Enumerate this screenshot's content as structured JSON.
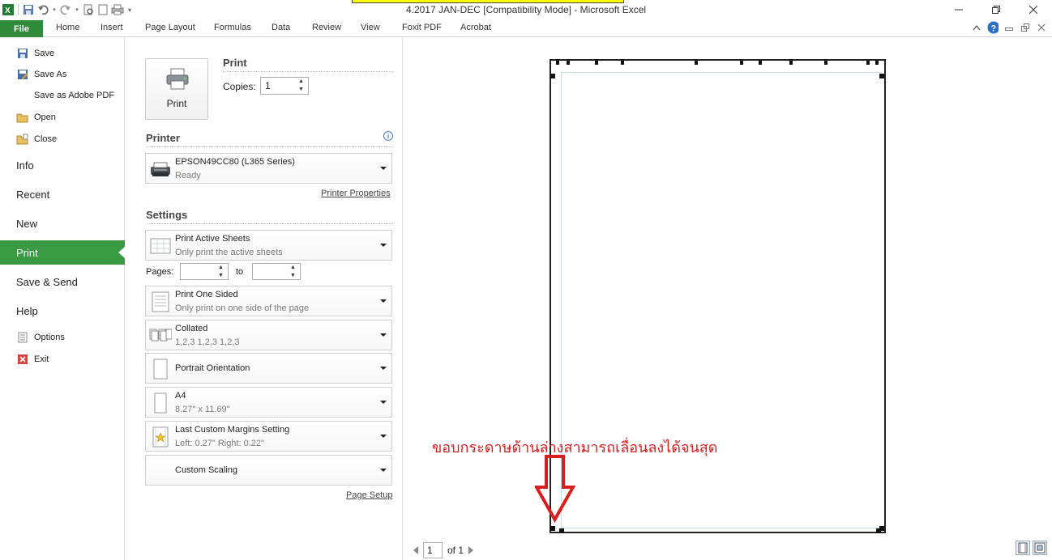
{
  "window": {
    "title": "4.2017 JAN-DEC  [Compatibility Mode]  -  Microsoft Excel",
    "controls": [
      "minimize",
      "restore",
      "close"
    ]
  },
  "ribbon": {
    "tabs": [
      "File",
      "Home",
      "Insert",
      "Page Layout",
      "Formulas",
      "Data",
      "Review",
      "View",
      "Foxit PDF",
      "Acrobat"
    ]
  },
  "nav": {
    "save": "Save",
    "save_as": "Save As",
    "save_adobe": "Save as Adobe PDF",
    "open": "Open",
    "close": "Close",
    "info": "Info",
    "recent": "Recent",
    "new": "New",
    "print": "Print",
    "save_send": "Save & Send",
    "help": "Help",
    "options": "Options",
    "exit": "Exit"
  },
  "print_panel": {
    "print_button": "Print",
    "print_heading": "Print",
    "copies_label": "Copies:",
    "copies_value": "1",
    "printer_heading": "Printer",
    "printer_name": "EPSON49CC80 (L365 Series)",
    "printer_status": "Ready",
    "printer_properties": "Printer Properties",
    "settings_heading": "Settings",
    "active_sheets": "Print Active Sheets",
    "active_sheets_desc": "Only print the active sheets",
    "pages_label": "Pages:",
    "pages_from": "",
    "to_label": "to",
    "pages_to": "",
    "one_sided": "Print One Sided",
    "one_sided_desc": "Only print on one side of the page",
    "collated": "Collated",
    "collated_desc": "1,2,3    1,2,3    1,2,3",
    "orientation": "Portrait Orientation",
    "paper_size": "A4",
    "paper_dims": "8.27\" x 11.69\"",
    "margins": "Last Custom Margins Setting",
    "margins_desc": "Left:  0.27\"    Right:  0.22\"",
    "scaling": "Custom Scaling",
    "page_setup": "Page Setup"
  },
  "preview": {
    "annotation": "ขอบกระดาษด้านล่างสามารถเลื่อนลงได้จนสุด",
    "annotation_color": "#d81e1e",
    "current_page": "1",
    "of_pages": "of 1"
  },
  "colors": {
    "file_tab": "#2f8a3a",
    "print_selected": "#3a9a44"
  }
}
